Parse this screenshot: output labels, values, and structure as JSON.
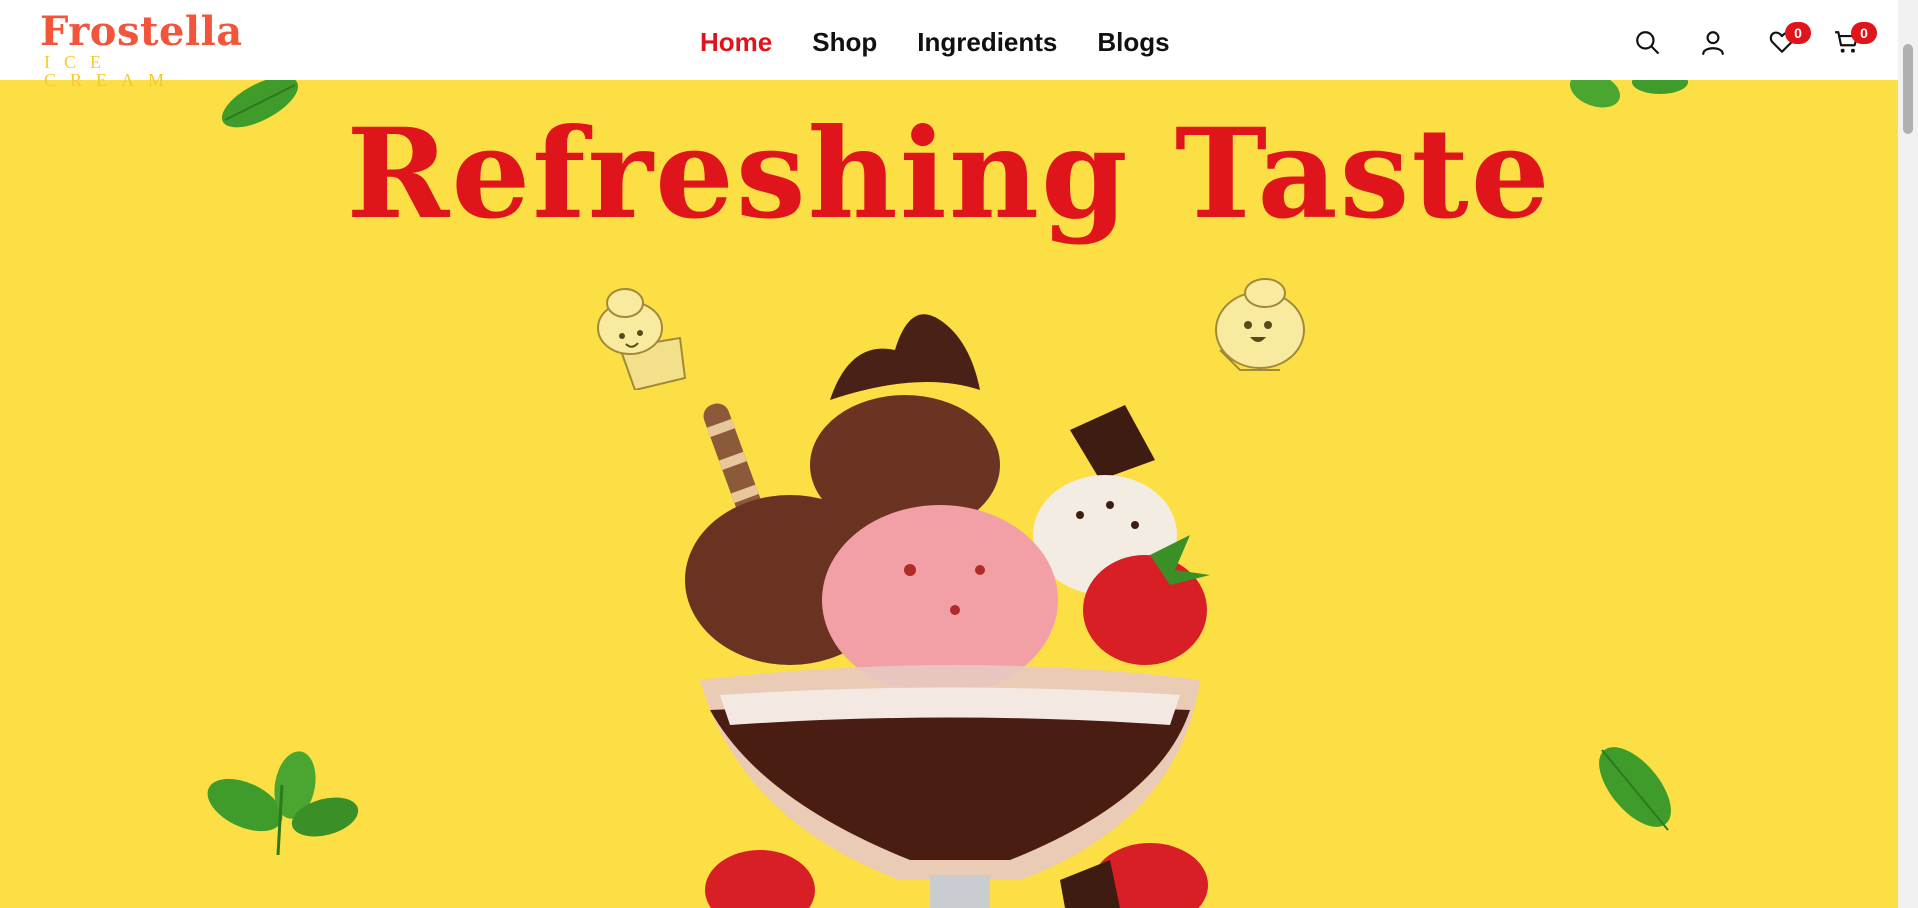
{
  "colors": {
    "accent_red": "#e0141b",
    "logo_red": "#f2553a",
    "logo_yellow": "#f7c92e",
    "hero_bg": "#fcdf44",
    "text_dark": "#111111",
    "leaf_green": "#3f9b2a",
    "cupcake": "#f3e08a",
    "chocolate": "#5a2a1a",
    "strawberry_scoop": "#f2a0a6",
    "strawberry": "#d81f26"
  },
  "logo": {
    "main": "Frostella",
    "sub": "ICE CREAM"
  },
  "nav": {
    "items": [
      {
        "label": "Home",
        "active": true
      },
      {
        "label": "Shop",
        "active": false
      },
      {
        "label": "Ingredients",
        "active": false
      },
      {
        "label": "Blogs",
        "active": false
      }
    ]
  },
  "header_icons": {
    "search": {
      "icon": "search-icon"
    },
    "account": {
      "icon": "user-icon"
    },
    "wishlist": {
      "icon": "heart-icon",
      "count": "0"
    },
    "cart": {
      "icon": "cart-icon",
      "count": "0"
    }
  },
  "hero": {
    "title": "Refreshing Taste",
    "image": "ice-cream-sundae-image"
  }
}
